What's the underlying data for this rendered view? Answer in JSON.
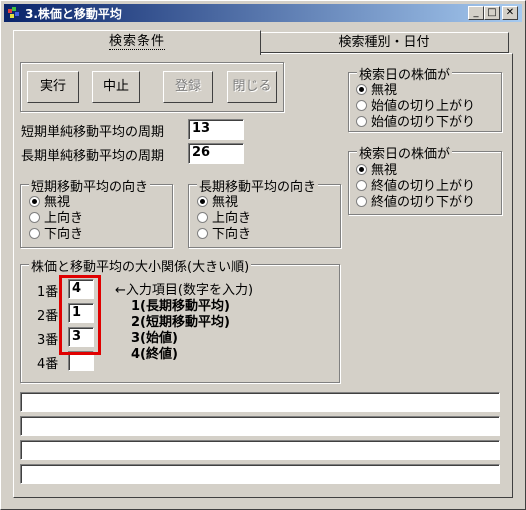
{
  "window": {
    "title": "3.株価と移動平均",
    "controls": [
      "minimize",
      "maximize",
      "close"
    ]
  },
  "tabs": [
    {
      "label": "検索条件",
      "active": true
    },
    {
      "label": "検索種別・日付",
      "active": false
    }
  ],
  "toolbar": {
    "buttons": [
      {
        "label": "実行",
        "enabled": true
      },
      {
        "label": "中止",
        "enabled": true
      },
      {
        "label": "登録",
        "enabled": false
      },
      {
        "label": "閉じる",
        "enabled": false
      }
    ]
  },
  "short_period": {
    "label": "短期単純移動平均の周期",
    "value": "13"
  },
  "long_period": {
    "label": "長期単純移動平均の周期",
    "value": "26"
  },
  "short_direction": {
    "title": "短期移動平均の向き",
    "options": [
      "無視",
      "上向き",
      "下向き"
    ],
    "selected": 0
  },
  "long_direction": {
    "title": "長期移動平均の向き",
    "options": [
      "無視",
      "上向き",
      "下向き"
    ],
    "selected": 0
  },
  "open_price_filter": {
    "title": "検索日の株価が",
    "options": [
      "無視",
      "始値の切り上がり",
      "始値の切り下がり"
    ],
    "selected": 0
  },
  "close_price_filter": {
    "title": "検索日の株価が",
    "options": [
      "無視",
      "終値の切り上がり",
      "終値の切り下がり"
    ],
    "selected": 0
  },
  "ranking": {
    "title": "株価と移動平均の大小関係(大きい順)",
    "rows": [
      {
        "label": "1番",
        "value": "4"
      },
      {
        "label": "2番",
        "value": "1"
      },
      {
        "label": "3番",
        "value": "3"
      },
      {
        "label": "4番",
        "value": ""
      }
    ],
    "hint": "←入力項目(数字を入力)",
    "items": [
      "1(長期移動平均)",
      "2(短期移動平均)",
      "3(始値)",
      "4(終値)"
    ]
  },
  "status_bars": [
    "",
    "",
    "",
    ""
  ],
  "colors": {
    "highlight_box": "#e00000",
    "titlebar_start": "#0a246a",
    "titlebar_end": "#a6caf0"
  }
}
